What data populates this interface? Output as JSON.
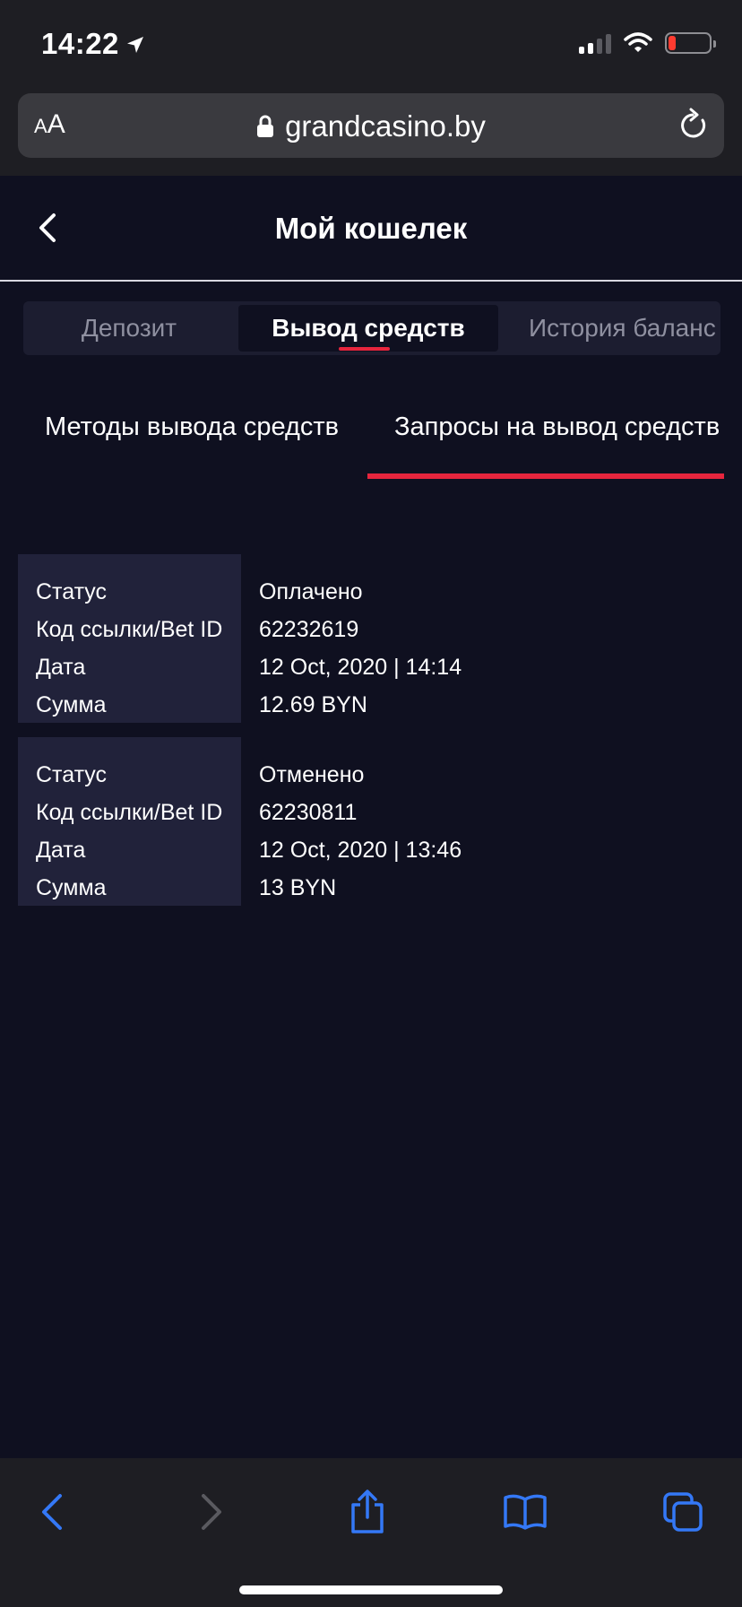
{
  "status_bar": {
    "time": "14:22",
    "icons": [
      "location-arrow-icon",
      "signal-icon",
      "wifi-icon",
      "battery-low-icon"
    ]
  },
  "browser": {
    "text_size_label_small": "A",
    "text_size_label_large": "A",
    "domain": "grandcasino.by",
    "icons": [
      "lock-icon",
      "reload-icon"
    ]
  },
  "header": {
    "title": "Мой кошелек",
    "back_icon": "chevron-left-icon"
  },
  "wallet_tabs": {
    "items": [
      {
        "label": "Депозит",
        "active": false
      },
      {
        "label": "Вывод средств",
        "active": true
      },
      {
        "label": "История баланс",
        "active": false
      }
    ]
  },
  "subtabs": {
    "items": [
      {
        "label": "Методы вывода средств",
        "active": false
      },
      {
        "label": "Запросы на вывод средств",
        "active": true
      }
    ]
  },
  "requests": [
    {
      "labels": [
        "Статус",
        "Код ссылки/Bet ID",
        "Дата",
        "Сумма"
      ],
      "status": "Оплачено",
      "bet_id": "62232619",
      "date": "12 Oct, 2020 | 14:14",
      "amount": "12.69 BYN"
    },
    {
      "labels": [
        "Статус",
        "Код ссылки/Bet ID",
        "Дата",
        "Сумма"
      ],
      "status": "Отменено",
      "bet_id": "62230811",
      "date": "12 Oct, 2020 | 13:46",
      "amount": "13 BYN"
    }
  ],
  "toolbar": {
    "icons": [
      "back-arrow-icon",
      "forward-arrow-icon",
      "share-icon",
      "bookmarks-icon",
      "tabs-icon"
    ]
  },
  "colors": {
    "background": "#0f1020",
    "accent": "#e6253d",
    "card_label_bg": "#21223a",
    "safari_blue": "#3478f6"
  }
}
